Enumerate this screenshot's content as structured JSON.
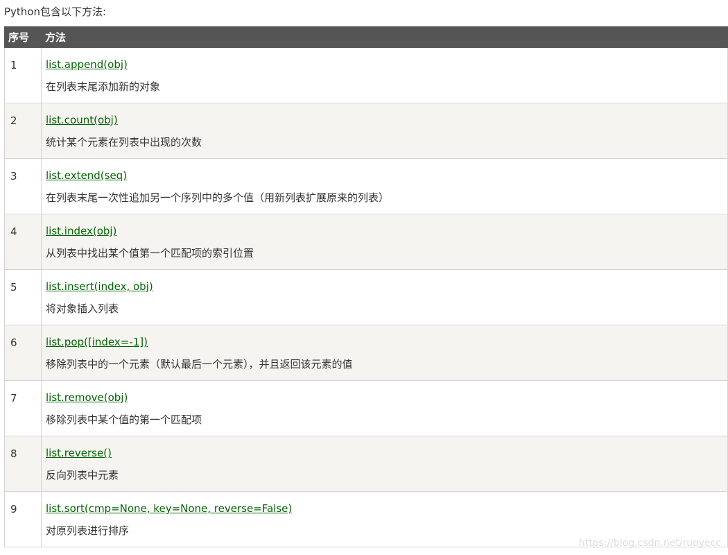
{
  "intro": "Python包含以下方法:",
  "table": {
    "headers": {
      "number": "序号",
      "method": "方法"
    },
    "rows": [
      {
        "num": "1",
        "method": "list.append(obj)",
        "desc": "在列表末尾添加新的对象"
      },
      {
        "num": "2",
        "method": "list.count(obj)",
        "desc": "统计某个元素在列表中出现的次数"
      },
      {
        "num": "3",
        "method": "list.extend(seq)",
        "desc": "在列表末尾一次性追加另一个序列中的多个值（用新列表扩展原来的列表）"
      },
      {
        "num": "4",
        "method": "list.index(obj)",
        "desc": "从列表中找出某个值第一个匹配项的索引位置"
      },
      {
        "num": "5",
        "method": "list.insert(index, obj)",
        "desc": "将对象插入列表"
      },
      {
        "num": "6",
        "method": "list.pop([index=-1])",
        "desc": "移除列表中的一个元素（默认最后一个元素），并且返回该元素的值"
      },
      {
        "num": "7",
        "method": "list.remove(obj)",
        "desc": "移除列表中某个值的第一个匹配项"
      },
      {
        "num": "8",
        "method": "list.reverse()",
        "desc": "反向列表中元素"
      },
      {
        "num": "9",
        "method": "list.sort(cmp=None, key=None, reverse=False)",
        "desc": "对原列表进行排序"
      }
    ]
  },
  "watermark": "https://blog.csdn.net/ruoyecc",
  "colors": {
    "header_bg": "#555555",
    "link": "#006600",
    "alt_row_bg": "#f6f4f0",
    "border": "#d4d4d4"
  }
}
